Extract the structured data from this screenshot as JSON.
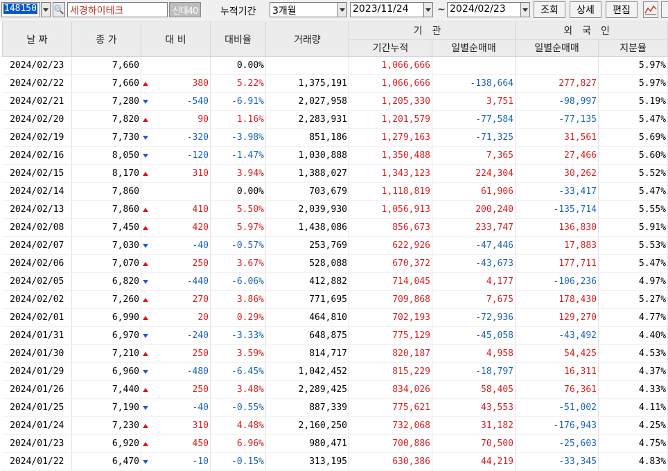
{
  "toolbar": {
    "code": "148150",
    "name": "세경하이테크",
    "badge": "신대40",
    "period_label": "누적기간",
    "period_value": "3개월",
    "date_from": "2023/11/24",
    "range_sep": "~",
    "date_to": "2024/02/23",
    "query_button": "조회",
    "detail_button": "상세",
    "edit_button": "편집"
  },
  "headers": {
    "date": "날 짜",
    "close": "종 가",
    "change": "대 비",
    "change_rate": "대비율",
    "volume": "거래량",
    "institution": "기관",
    "foreign": "외국인",
    "inst_cumulative": "기간누적",
    "inst_daily": "일별순매매",
    "foreign_daily": "일별순매매",
    "foreign_ratio": "지분율"
  },
  "colors": {
    "up": "#d81e1e",
    "down": "#1a63b8",
    "header_bg": "#ececec"
  },
  "rows": [
    {
      "date": "2024/02/23",
      "close": "7,660",
      "dir": "flat",
      "change": "",
      "rate": "0.00%",
      "volume": "",
      "inst_cum": "1,066,666",
      "inst_daily": "",
      "foreign_daily": "",
      "ratio": "5.97%"
    },
    {
      "date": "2024/02/22",
      "close": "7,660",
      "dir": "up",
      "change": "380",
      "rate": "5.22%",
      "volume": "1,375,191",
      "inst_cum": "1,066,666",
      "inst_daily": "-138,664",
      "foreign_daily": "277,827",
      "ratio": "5.97%"
    },
    {
      "date": "2024/02/21",
      "close": "7,280",
      "dir": "down",
      "change": "-540",
      "rate": "-6.91%",
      "volume": "2,027,958",
      "inst_cum": "1,205,330",
      "inst_daily": "3,751",
      "foreign_daily": "-98,997",
      "ratio": "5.19%"
    },
    {
      "date": "2024/02/20",
      "close": "7,820",
      "dir": "up",
      "change": "90",
      "rate": "1.16%",
      "volume": "2,283,931",
      "inst_cum": "1,201,579",
      "inst_daily": "-77,584",
      "foreign_daily": "-77,135",
      "ratio": "5.47%"
    },
    {
      "date": "2024/02/19",
      "close": "7,730",
      "dir": "down",
      "change": "-320",
      "rate": "-3.98%",
      "volume": "851,186",
      "inst_cum": "1,279,163",
      "inst_daily": "-71,325",
      "foreign_daily": "31,561",
      "ratio": "5.69%"
    },
    {
      "date": "2024/02/16",
      "close": "8,050",
      "dir": "down",
      "change": "-120",
      "rate": "-1.47%",
      "volume": "1,030,888",
      "inst_cum": "1,350,488",
      "inst_daily": "7,365",
      "foreign_daily": "27,466",
      "ratio": "5.60%"
    },
    {
      "date": "2024/02/15",
      "close": "8,170",
      "dir": "up",
      "change": "310",
      "rate": "3.94%",
      "volume": "1,388,027",
      "inst_cum": "1,343,123",
      "inst_daily": "224,304",
      "foreign_daily": "30,262",
      "ratio": "5.52%"
    },
    {
      "date": "2024/02/14",
      "close": "7,860",
      "dir": "flat",
      "change": "",
      "rate": "0.00%",
      "volume": "703,679",
      "inst_cum": "1,118,819",
      "inst_daily": "61,906",
      "foreign_daily": "-33,417",
      "ratio": "5.47%"
    },
    {
      "date": "2024/02/13",
      "close": "7,860",
      "dir": "up",
      "change": "410",
      "rate": "5.50%",
      "volume": "2,039,930",
      "inst_cum": "1,056,913",
      "inst_daily": "200,240",
      "foreign_daily": "-135,714",
      "ratio": "5.55%"
    },
    {
      "date": "2024/02/08",
      "close": "7,450",
      "dir": "up",
      "change": "420",
      "rate": "5.97%",
      "volume": "1,438,086",
      "inst_cum": "856,673",
      "inst_daily": "233,747",
      "foreign_daily": "136,830",
      "ratio": "5.91%"
    },
    {
      "date": "2024/02/07",
      "close": "7,030",
      "dir": "down",
      "change": "-40",
      "rate": "-0.57%",
      "volume": "253,769",
      "inst_cum": "622,926",
      "inst_daily": "-47,446",
      "foreign_daily": "17,883",
      "ratio": "5.53%"
    },
    {
      "date": "2024/02/06",
      "close": "7,070",
      "dir": "up",
      "change": "250",
      "rate": "3.67%",
      "volume": "528,088",
      "inst_cum": "670,372",
      "inst_daily": "-43,673",
      "foreign_daily": "177,711",
      "ratio": "5.47%"
    },
    {
      "date": "2024/02/05",
      "close": "6,820",
      "dir": "down",
      "change": "-440",
      "rate": "-6.06%",
      "volume": "412,882",
      "inst_cum": "714,045",
      "inst_daily": "4,177",
      "foreign_daily": "-106,236",
      "ratio": "4.97%"
    },
    {
      "date": "2024/02/02",
      "close": "7,260",
      "dir": "up",
      "change": "270",
      "rate": "3.86%",
      "volume": "771,695",
      "inst_cum": "709,868",
      "inst_daily": "7,675",
      "foreign_daily": "178,430",
      "ratio": "5.27%"
    },
    {
      "date": "2024/02/01",
      "close": "6,990",
      "dir": "up",
      "change": "20",
      "rate": "0.29%",
      "volume": "464,810",
      "inst_cum": "702,193",
      "inst_daily": "-72,936",
      "foreign_daily": "129,270",
      "ratio": "4.77%"
    },
    {
      "date": "2024/01/31",
      "close": "6,970",
      "dir": "down",
      "change": "-240",
      "rate": "-3.33%",
      "volume": "648,875",
      "inst_cum": "775,129",
      "inst_daily": "-45,058",
      "foreign_daily": "-43,492",
      "ratio": "4.40%"
    },
    {
      "date": "2024/01/30",
      "close": "7,210",
      "dir": "up",
      "change": "250",
      "rate": "3.59%",
      "volume": "814,717",
      "inst_cum": "820,187",
      "inst_daily": "4,958",
      "foreign_daily": "54,425",
      "ratio": "4.53%"
    },
    {
      "date": "2024/01/29",
      "close": "6,960",
      "dir": "down",
      "change": "-480",
      "rate": "-6.45%",
      "volume": "1,042,452",
      "inst_cum": "815,229",
      "inst_daily": "-18,797",
      "foreign_daily": "16,311",
      "ratio": "4.37%"
    },
    {
      "date": "2024/01/26",
      "close": "7,440",
      "dir": "up",
      "change": "250",
      "rate": "3.48%",
      "volume": "2,289,425",
      "inst_cum": "834,026",
      "inst_daily": "58,405",
      "foreign_daily": "76,361",
      "ratio": "4.33%"
    },
    {
      "date": "2024/01/25",
      "close": "7,190",
      "dir": "down",
      "change": "-40",
      "rate": "-0.55%",
      "volume": "887,339",
      "inst_cum": "775,621",
      "inst_daily": "43,553",
      "foreign_daily": "-51,002",
      "ratio": "4.11%"
    },
    {
      "date": "2024/01/24",
      "close": "7,230",
      "dir": "up",
      "change": "310",
      "rate": "4.48%",
      "volume": "2,160,250",
      "inst_cum": "732,068",
      "inst_daily": "31,182",
      "foreign_daily": "-176,943",
      "ratio": "4.25%"
    },
    {
      "date": "2024/01/23",
      "close": "6,920",
      "dir": "up",
      "change": "450",
      "rate": "6.96%",
      "volume": "980,471",
      "inst_cum": "700,886",
      "inst_daily": "70,500",
      "foreign_daily": "-25,603",
      "ratio": "4.75%"
    },
    {
      "date": "2024/01/22",
      "close": "6,470",
      "dir": "down",
      "change": "-10",
      "rate": "-0.15%",
      "volume": "313,195",
      "inst_cum": "630,386",
      "inst_daily": "44,219",
      "foreign_daily": "-33,345",
      "ratio": "4.83%"
    }
  ]
}
